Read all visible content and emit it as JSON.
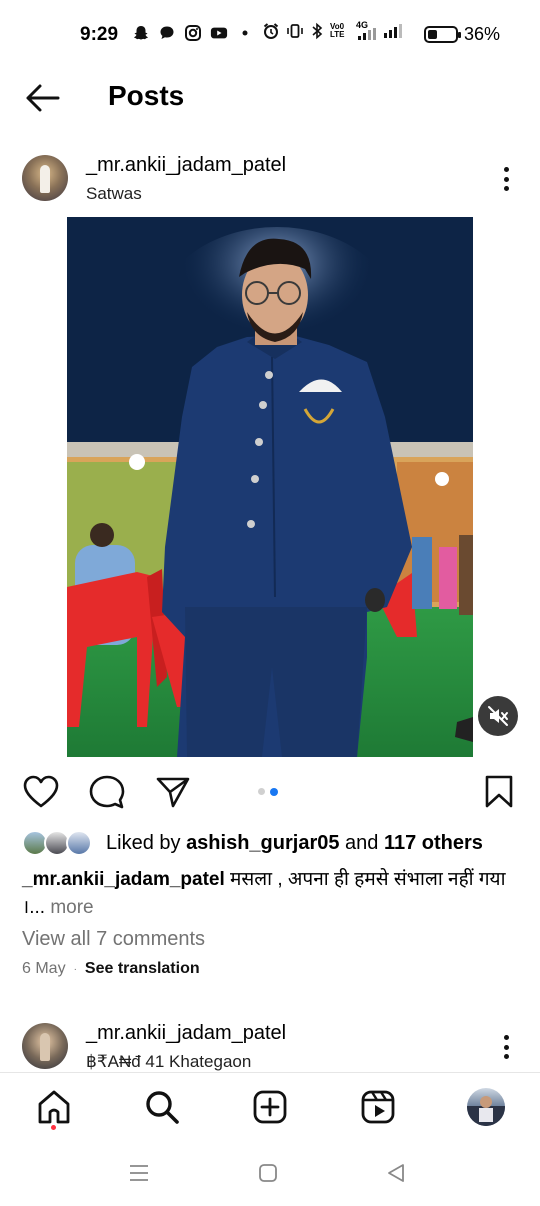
{
  "status_bar": {
    "time": "9:29",
    "battery_percent": "36%",
    "battery_level": 0.36,
    "network_label": "4G",
    "volte_label": "Vo0 LTE"
  },
  "header": {
    "title": "Posts"
  },
  "post": {
    "username": "_mr.ankii_jadam_patel",
    "location": "Satwas",
    "carousel_total": 2,
    "carousel_active": 2,
    "likes": {
      "prefix": "Liked by ",
      "top_liker": "ashish_gurjar05",
      "middle": " and ",
      "others": "117 others"
    },
    "caption": {
      "username": "_mr.ankii_jadam_patel",
      "text": " मसला , अपना ही हमसे संभाला नहीं गया ।...",
      "more_label": " more"
    },
    "comments_link": "View all 7 comments",
    "date": "6 May",
    "separator": "·",
    "translate_label": "See translation"
  },
  "next_post": {
    "username": "_mr.ankii_jadam_patel",
    "location": "฿₹A₦đ 41 Khategaon"
  },
  "icons": {
    "back": "arrow-left-icon",
    "more": "more-vertical-icon",
    "mute": "muted-speaker-icon",
    "like": "heart-icon",
    "comment": "comment-bubble-icon",
    "share": "paper-plane-icon",
    "save": "bookmark-icon",
    "home": "home-icon",
    "search": "search-icon",
    "create": "plus-square-icon",
    "reels": "reels-icon"
  },
  "colors": {
    "accent": "#1877f2",
    "muted_text": "#737373",
    "notification": "#ff3040"
  }
}
